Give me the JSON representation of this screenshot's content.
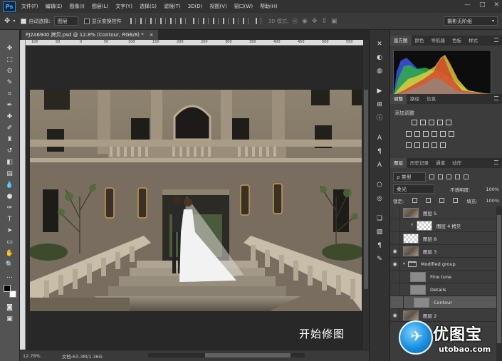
{
  "app": {
    "logo": "Ps"
  },
  "menu": [
    "文件(F)",
    "编辑(E)",
    "图像(I)",
    "图层(L)",
    "文字(Y)",
    "选择(S)",
    "滤镜(T)",
    "3D(D)",
    "视图(V)",
    "窗口(W)",
    "帮助(H)"
  ],
  "window_controls": [
    "—",
    "□",
    "✕"
  ],
  "options": {
    "auto_select_label": "自动选择:",
    "auto_select_target": "图层",
    "show_transform_label": "显示变换控件",
    "mode_3d_label": "3D 模式:",
    "workspace": "摄影无阶组"
  },
  "document": {
    "tab_title": "PJ2A6940 拷贝.psd @ 12.8% (Contour, RGB/8) *",
    "tab_close": "×",
    "ruler_ticks": [
      "100",
      "50",
      "0",
      "50",
      "100",
      "150",
      "200",
      "250",
      "300",
      "350",
      "400",
      "450",
      "500",
      "550"
    ],
    "caption": "开始修图"
  },
  "status": {
    "zoom": "12.78%",
    "doc_info": "文档:63.3M/1.36G"
  },
  "panels": {
    "top_tabs": [
      "直方图",
      "颜色",
      "导航器",
      "色板",
      "样式"
    ],
    "adj_tabs": [
      "调整",
      "路径",
      "信息"
    ],
    "adj_title": "添加调整",
    "layers_tabs": [
      "图层",
      "历史记录",
      "通道",
      "动作"
    ],
    "filter_kind": "ρ 类型",
    "blend_mode": "柔光",
    "opacity_label": "不透明度:",
    "opacity_value": "100%",
    "lock_label": "锁定:",
    "fill_label": "填充:",
    "fill_value": "100%"
  },
  "layers": [
    {
      "name": "图层 5",
      "thumb": "photo",
      "visible": false,
      "selected": false,
      "indent": 0
    },
    {
      "name": "图层 4 拷贝",
      "thumb": "check",
      "visible": false,
      "selected": false,
      "indent": 1
    },
    {
      "name": "图层 8",
      "thumb": "check",
      "visible": false,
      "selected": false,
      "indent": 0
    },
    {
      "name": "图层 3",
      "thumb": "photo",
      "visible": true,
      "selected": false,
      "indent": 0
    },
    {
      "name": "Modified group",
      "thumb": "folder",
      "visible": true,
      "selected": false,
      "indent": 0
    },
    {
      "name": "Fine tune",
      "thumb": "gray",
      "visible": false,
      "selected": false,
      "indent": 1
    },
    {
      "name": "Details",
      "thumb": "gray",
      "visible": false,
      "selected": false,
      "indent": 1
    },
    {
      "name": "Contour",
      "thumb": "gray",
      "visible": false,
      "selected": true,
      "indent": 1
    },
    {
      "name": "图层 2",
      "thumb": "photo",
      "visible": true,
      "selected": false,
      "indent": 0
    }
  ],
  "watermark": {
    "title": "优图宝",
    "url": "utobao.com"
  },
  "colors": {
    "app_bg": "#282828",
    "toolbar": "#535353",
    "panel": "#3c3c3c",
    "ps_blue": "#2f89d8",
    "watermark_blue": "#1a8fe0"
  }
}
